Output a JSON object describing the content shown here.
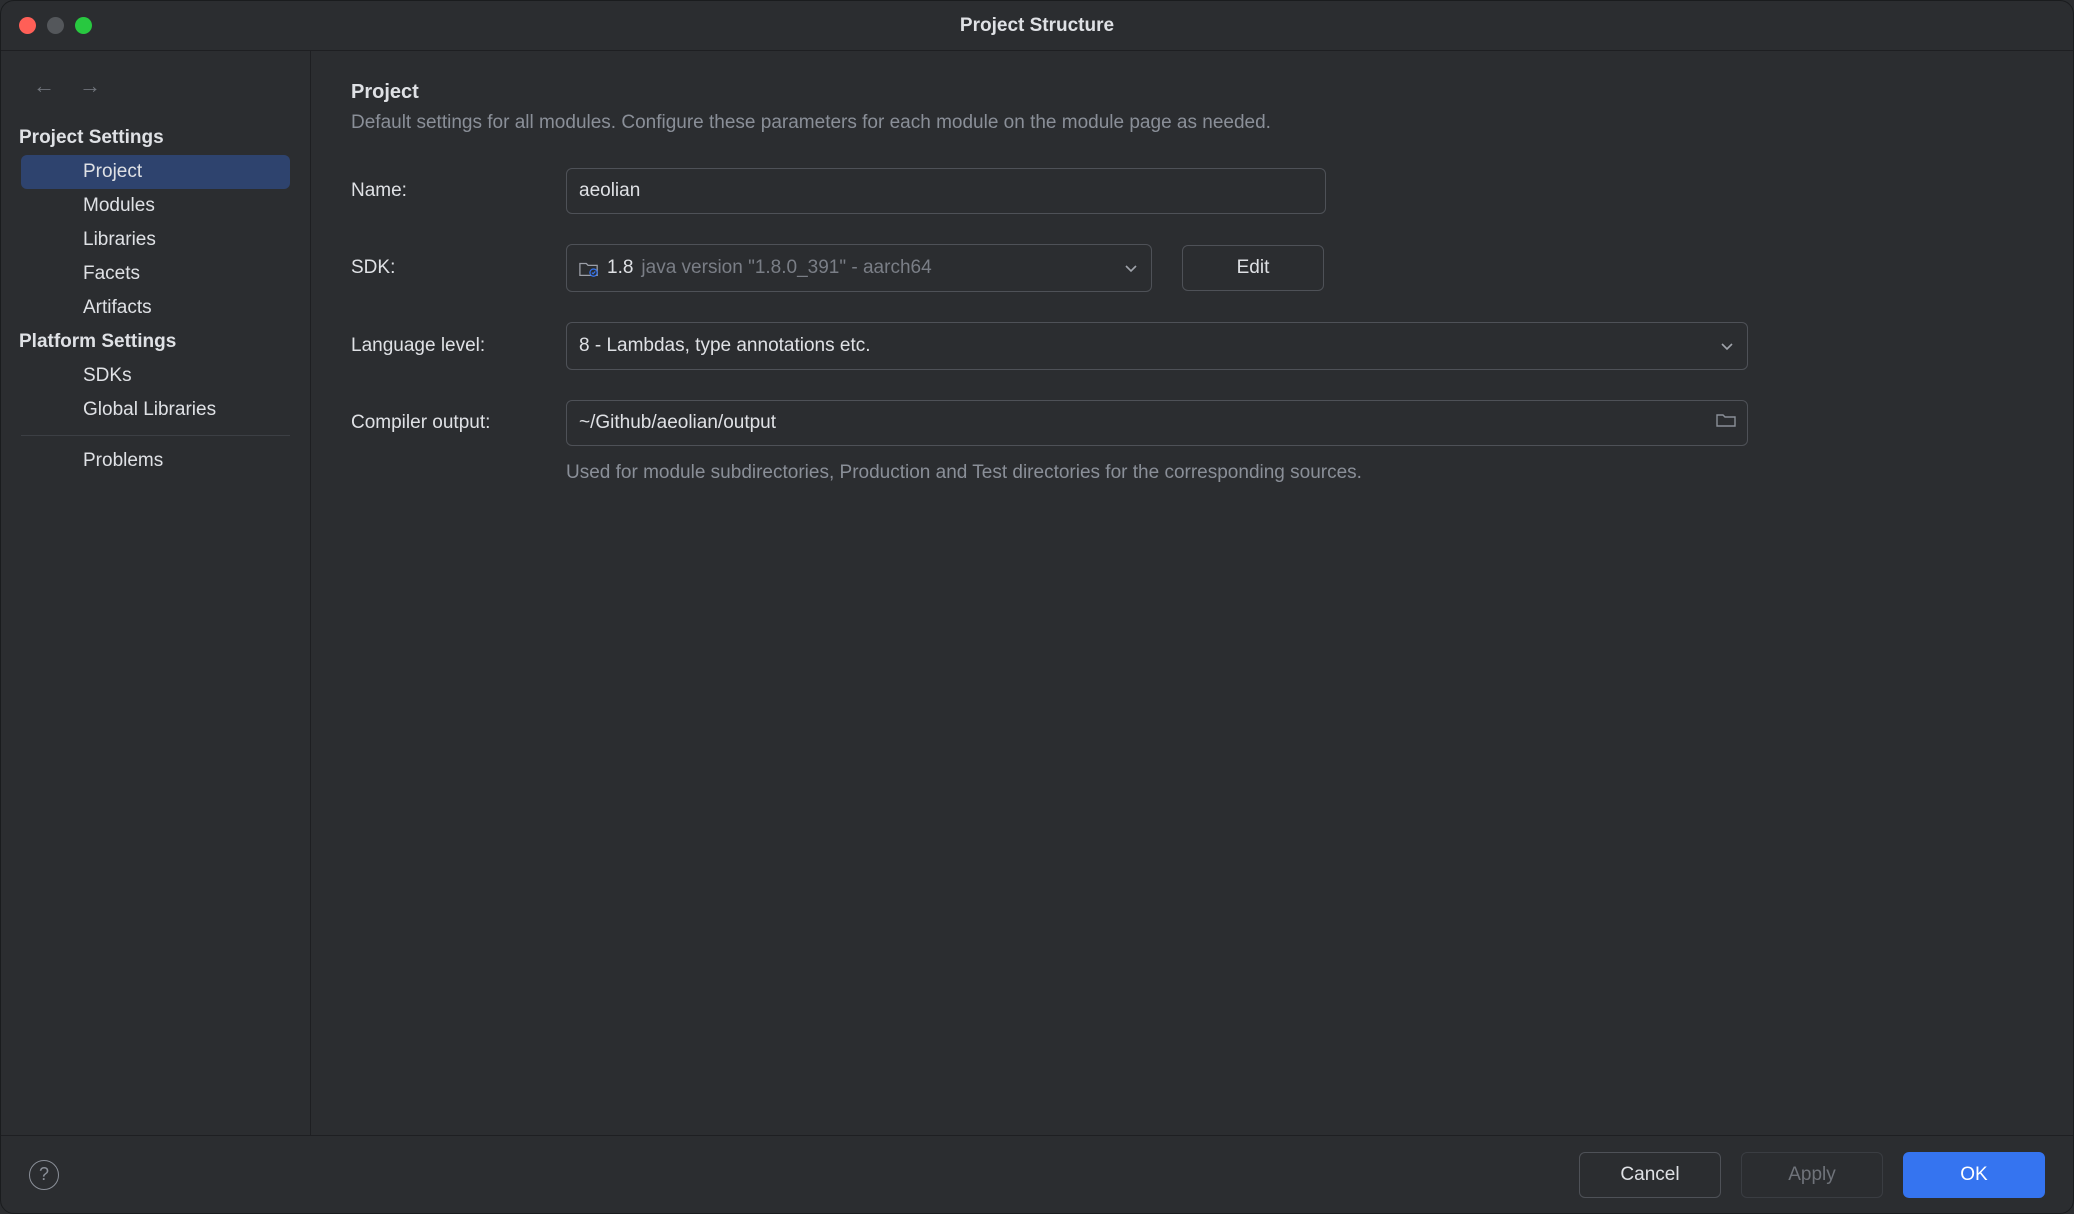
{
  "window": {
    "title": "Project Structure"
  },
  "sidebar": {
    "section1_title": "Project Settings",
    "items1": [
      {
        "label": "Project",
        "selected": true
      },
      {
        "label": "Modules"
      },
      {
        "label": "Libraries"
      },
      {
        "label": "Facets"
      },
      {
        "label": "Artifacts"
      }
    ],
    "section2_title": "Platform Settings",
    "items2": [
      {
        "label": "SDKs"
      },
      {
        "label": "Global Libraries"
      }
    ],
    "items3": [
      {
        "label": "Problems"
      }
    ]
  },
  "main": {
    "heading": "Project",
    "subheading": "Default settings for all modules. Configure these parameters for each module on the module page as needed.",
    "name_label": "Name:",
    "name_value": "aeolian",
    "sdk_label": "SDK:",
    "sdk_value_prefix": "1.8",
    "sdk_value_detail": "java version \"1.8.0_391\" - aarch64",
    "edit_label": "Edit",
    "lang_label": "Language level:",
    "lang_value": "8 - Lambdas, type annotations etc.",
    "comp_label": "Compiler output:",
    "comp_value": "~/Github/aeolian/output",
    "comp_hint": "Used for module subdirectories, Production and Test directories for the corresponding sources."
  },
  "footer": {
    "cancel": "Cancel",
    "apply": "Apply",
    "ok": "OK"
  }
}
